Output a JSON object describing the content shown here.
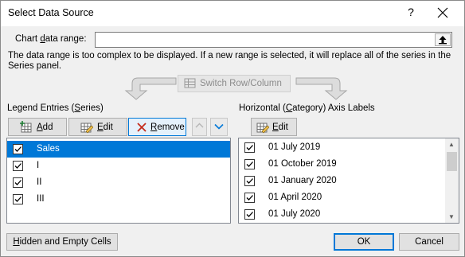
{
  "window": {
    "title": "Select Data Source",
    "help": "?"
  },
  "range": {
    "label": "Chart data range:",
    "value": ""
  },
  "note": "The data range is too complex to be displayed. If a new range is selected, it will replace all of the series in the Series panel.",
  "switch_label": "Switch Row/Column",
  "legend": {
    "heading": "Legend Entries (Series)",
    "add": "Add",
    "edit": "Edit",
    "remove": "Remove",
    "items": [
      {
        "label": "Sales",
        "checked": true,
        "selected": true
      },
      {
        "label": "I",
        "checked": true,
        "selected": false
      },
      {
        "label": "II",
        "checked": true,
        "selected": false
      },
      {
        "label": "III",
        "checked": true,
        "selected": false
      }
    ]
  },
  "axis": {
    "heading": "Horizontal (Category) Axis Labels",
    "edit": "Edit",
    "items": [
      {
        "label": "01 July 2019",
        "checked": true
      },
      {
        "label": "01 October 2019",
        "checked": true
      },
      {
        "label": "01 January 2020",
        "checked": true
      },
      {
        "label": "01 April 2020",
        "checked": true
      },
      {
        "label": "01 July 2020",
        "checked": true
      }
    ]
  },
  "footer": {
    "hidden_cells": "Hidden and Empty Cells",
    "ok": "OK",
    "cancel": "Cancel"
  },
  "colors": {
    "accent": "#0078d7",
    "remove_red": "#c42b1c"
  }
}
